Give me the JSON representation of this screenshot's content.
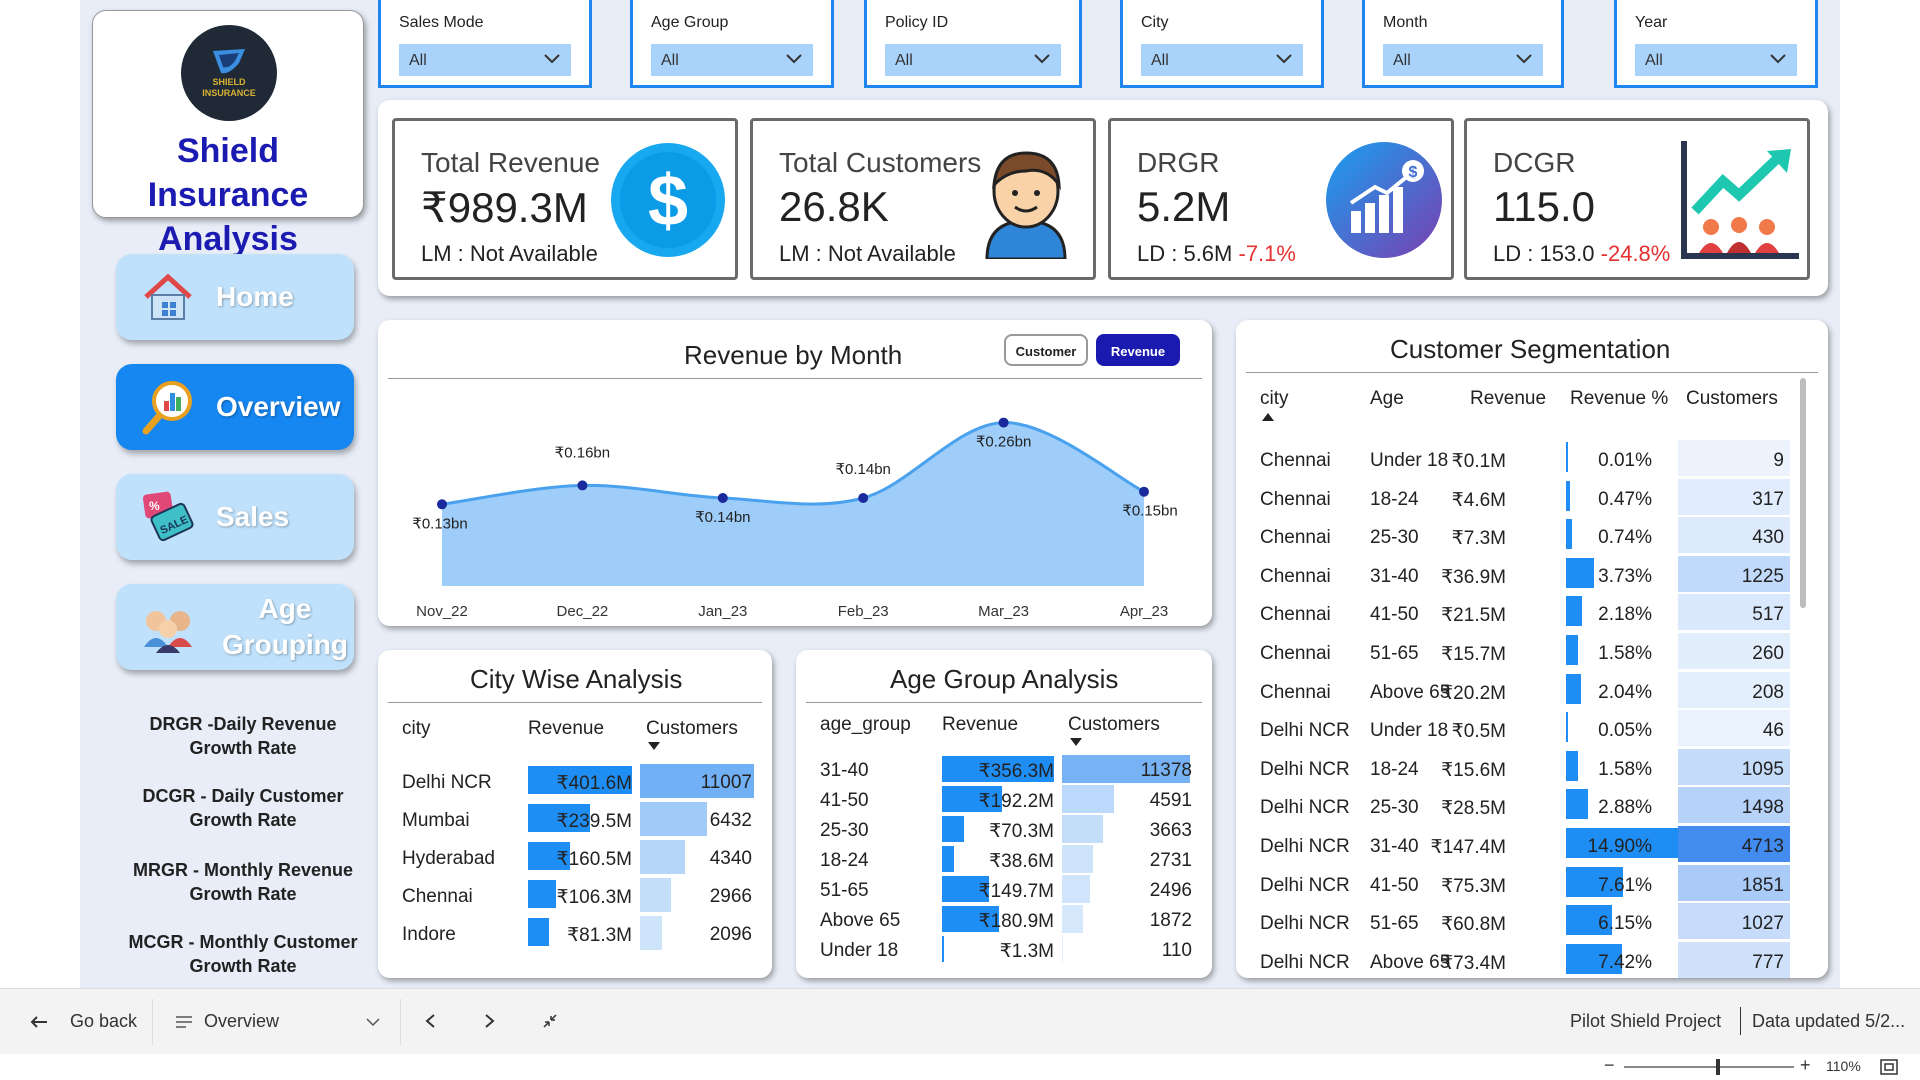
{
  "logo": {
    "badge_line1": "SHIELD",
    "badge_line2": "INSURANCE",
    "title": "Shield Insurance Analysis"
  },
  "nav": [
    {
      "label": "Home",
      "icon": "home-icon",
      "active": false
    },
    {
      "label": "Overview",
      "icon": "magnifier-chart-icon",
      "active": true
    },
    {
      "label": "Sales",
      "icon": "sale-tag-icon",
      "active": false
    },
    {
      "label": "Age Grouping",
      "icon": "people-group-icon",
      "active": false
    }
  ],
  "glossary": [
    {
      "text": "DRGR  -Daily Revenue Growth Rate"
    },
    {
      "text": "DCGR - Daily Customer Growth Rate"
    },
    {
      "text": "MRGR - Monthly Revenue Growth Rate"
    },
    {
      "text": "MCGR - Monthly Customer Growth Rate"
    }
  ],
  "filters": [
    {
      "label": "Sales Mode",
      "value": "All"
    },
    {
      "label": "Age Group",
      "value": "All"
    },
    {
      "label": "Policy ID",
      "value": "All"
    },
    {
      "label": "City",
      "value": "All"
    },
    {
      "label": "Month",
      "value": "All"
    },
    {
      "label": "Year",
      "value": "All"
    }
  ],
  "kpis": [
    {
      "title": "Total Revenue",
      "value": "₹989.3M",
      "sub": "LM : Not Available",
      "delta": "",
      "icon": "dollar-coin-icon"
    },
    {
      "title": "Total Customers",
      "value": "26.8K",
      "sub": "LM : Not Available",
      "delta": "",
      "icon": "customer-avatar-icon"
    },
    {
      "title": "DRGR",
      "value": "5.2M",
      "sub": "LD : 5.6M",
      "delta": "-7.1%",
      "icon": "growth-bars-icon"
    },
    {
      "title": "DCGR",
      "value": "115.0",
      "sub": "LD : 153.0",
      "delta": "-24.8%",
      "icon": "growth-chart-people-icon"
    }
  ],
  "revenue_chart": {
    "title": "Revenue by Month",
    "toggle_customer": "Customer",
    "toggle_revenue": "Revenue"
  },
  "chart_data": {
    "type": "area",
    "title": "Revenue by Month",
    "categories": [
      "Nov_22",
      "Dec_22",
      "Jan_23",
      "Feb_23",
      "Mar_23",
      "Apr_23"
    ],
    "values": [
      0.13,
      0.16,
      0.14,
      0.14,
      0.26,
      0.15
    ],
    "labels": [
      "₹0.13bn",
      "₹0.16bn",
      "₹0.14bn",
      "₹0.14bn",
      "₹0.26bn",
      "₹0.15bn"
    ],
    "ylim": [
      0,
      0.28
    ],
    "color": "#9fcdfa",
    "line_color": "#4aa2ee",
    "point_color": "#1a2a9c"
  },
  "city_table": {
    "title": "City Wise Analysis",
    "headers": [
      "city",
      "Revenue",
      "Customers"
    ],
    "rows": [
      {
        "city": "Delhi NCR",
        "revenue": "₹401.6M",
        "rev_value": 401.6,
        "customers": "11007",
        "cust_value": 11007
      },
      {
        "city": "Mumbai",
        "revenue": "₹239.5M",
        "rev_value": 239.5,
        "customers": "6432",
        "cust_value": 6432
      },
      {
        "city": "Hyderabad",
        "revenue": "₹160.5M",
        "rev_value": 160.5,
        "customers": "4340",
        "cust_value": 4340
      },
      {
        "city": "Chennai",
        "revenue": "₹106.3M",
        "rev_value": 106.3,
        "customers": "2966",
        "cust_value": 2966
      },
      {
        "city": "Indore",
        "revenue": "₹81.3M",
        "rev_value": 81.3,
        "customers": "2096",
        "cust_value": 2096
      }
    ]
  },
  "age_table": {
    "title": "Age Group Analysis",
    "headers": [
      "age_group",
      "Revenue",
      "Customers"
    ],
    "rows": [
      {
        "group": "31-40",
        "revenue": "₹356.3M",
        "rev_value": 356.3,
        "customers": "11378",
        "cust_value": 11378
      },
      {
        "group": "41-50",
        "revenue": "₹192.2M",
        "rev_value": 192.2,
        "customers": "4591",
        "cust_value": 4591
      },
      {
        "group": "25-30",
        "revenue": "₹70.3M",
        "rev_value": 70.3,
        "customers": "3663",
        "cust_value": 3663
      },
      {
        "group": "18-24",
        "revenue": "₹38.6M",
        "rev_value": 38.6,
        "customers": "2731",
        "cust_value": 2731
      },
      {
        "group": "51-65",
        "revenue": "₹149.7M",
        "rev_value": 149.7,
        "customers": "2496",
        "cust_value": 2496
      },
      {
        "group": "Above 65",
        "revenue": "₹180.9M",
        "rev_value": 180.9,
        "customers": "1872",
        "cust_value": 1872
      },
      {
        "group": "Under 18",
        "revenue": "₹1.3M",
        "rev_value": 1.3,
        "customers": "110",
        "cust_value": 110
      }
    ]
  },
  "segment_table": {
    "title": "Customer Segmentation",
    "headers": [
      "city",
      "Age",
      "Revenue",
      "Revenue %",
      "Customers"
    ],
    "rows": [
      {
        "city": "Chennai",
        "age": "Under 18",
        "revenue": "₹0.1M",
        "pct": "0.01%",
        "pct_value": 0.01,
        "customers": "9",
        "cust_value": 9
      },
      {
        "city": "Chennai",
        "age": "18-24",
        "revenue": "₹4.6M",
        "pct": "0.47%",
        "pct_value": 0.47,
        "customers": "317",
        "cust_value": 317
      },
      {
        "city": "Chennai",
        "age": "25-30",
        "revenue": "₹7.3M",
        "pct": "0.74%",
        "pct_value": 0.74,
        "customers": "430",
        "cust_value": 430
      },
      {
        "city": "Chennai",
        "age": "31-40",
        "revenue": "₹36.9M",
        "pct": "3.73%",
        "pct_value": 3.73,
        "customers": "1225",
        "cust_value": 1225
      },
      {
        "city": "Chennai",
        "age": "41-50",
        "revenue": "₹21.5M",
        "pct": "2.18%",
        "pct_value": 2.18,
        "customers": "517",
        "cust_value": 517
      },
      {
        "city": "Chennai",
        "age": "51-65",
        "revenue": "₹15.7M",
        "pct": "1.58%",
        "pct_value": 1.58,
        "customers": "260",
        "cust_value": 260
      },
      {
        "city": "Chennai",
        "age": "Above 65",
        "revenue": "₹20.2M",
        "pct": "2.04%",
        "pct_value": 2.04,
        "customers": "208",
        "cust_value": 208
      },
      {
        "city": "Delhi NCR",
        "age": "Under 18",
        "revenue": "₹0.5M",
        "pct": "0.05%",
        "pct_value": 0.05,
        "customers": "46",
        "cust_value": 46
      },
      {
        "city": "Delhi NCR",
        "age": "18-24",
        "revenue": "₹15.6M",
        "pct": "1.58%",
        "pct_value": 1.58,
        "customers": "1095",
        "cust_value": 1095
      },
      {
        "city": "Delhi NCR",
        "age": "25-30",
        "revenue": "₹28.5M",
        "pct": "2.88%",
        "pct_value": 2.88,
        "customers": "1498",
        "cust_value": 1498
      },
      {
        "city": "Delhi NCR",
        "age": "31-40",
        "revenue": "₹147.4M",
        "pct": "14.90%",
        "pct_value": 14.9,
        "customers": "4713",
        "cust_value": 4713
      },
      {
        "city": "Delhi NCR",
        "age": "41-50",
        "revenue": "₹75.3M",
        "pct": "7.61%",
        "pct_value": 7.61,
        "customers": "1851",
        "cust_value": 1851
      },
      {
        "city": "Delhi NCR",
        "age": "51-65",
        "revenue": "₹60.8M",
        "pct": "6.15%",
        "pct_value": 6.15,
        "customers": "1027",
        "cust_value": 1027
      },
      {
        "city": "Delhi NCR",
        "age": "Above 65",
        "revenue": "₹73.4M",
        "pct": "7.42%",
        "pct_value": 7.42,
        "customers": "777",
        "cust_value": 777
      }
    ]
  },
  "footer": {
    "go_back": "Go back",
    "page_select": "Overview",
    "project": "Pilot Shield Project",
    "updated": "Data updated 5/2...",
    "zoom": "110%",
    "zoom_level": 0.55
  }
}
